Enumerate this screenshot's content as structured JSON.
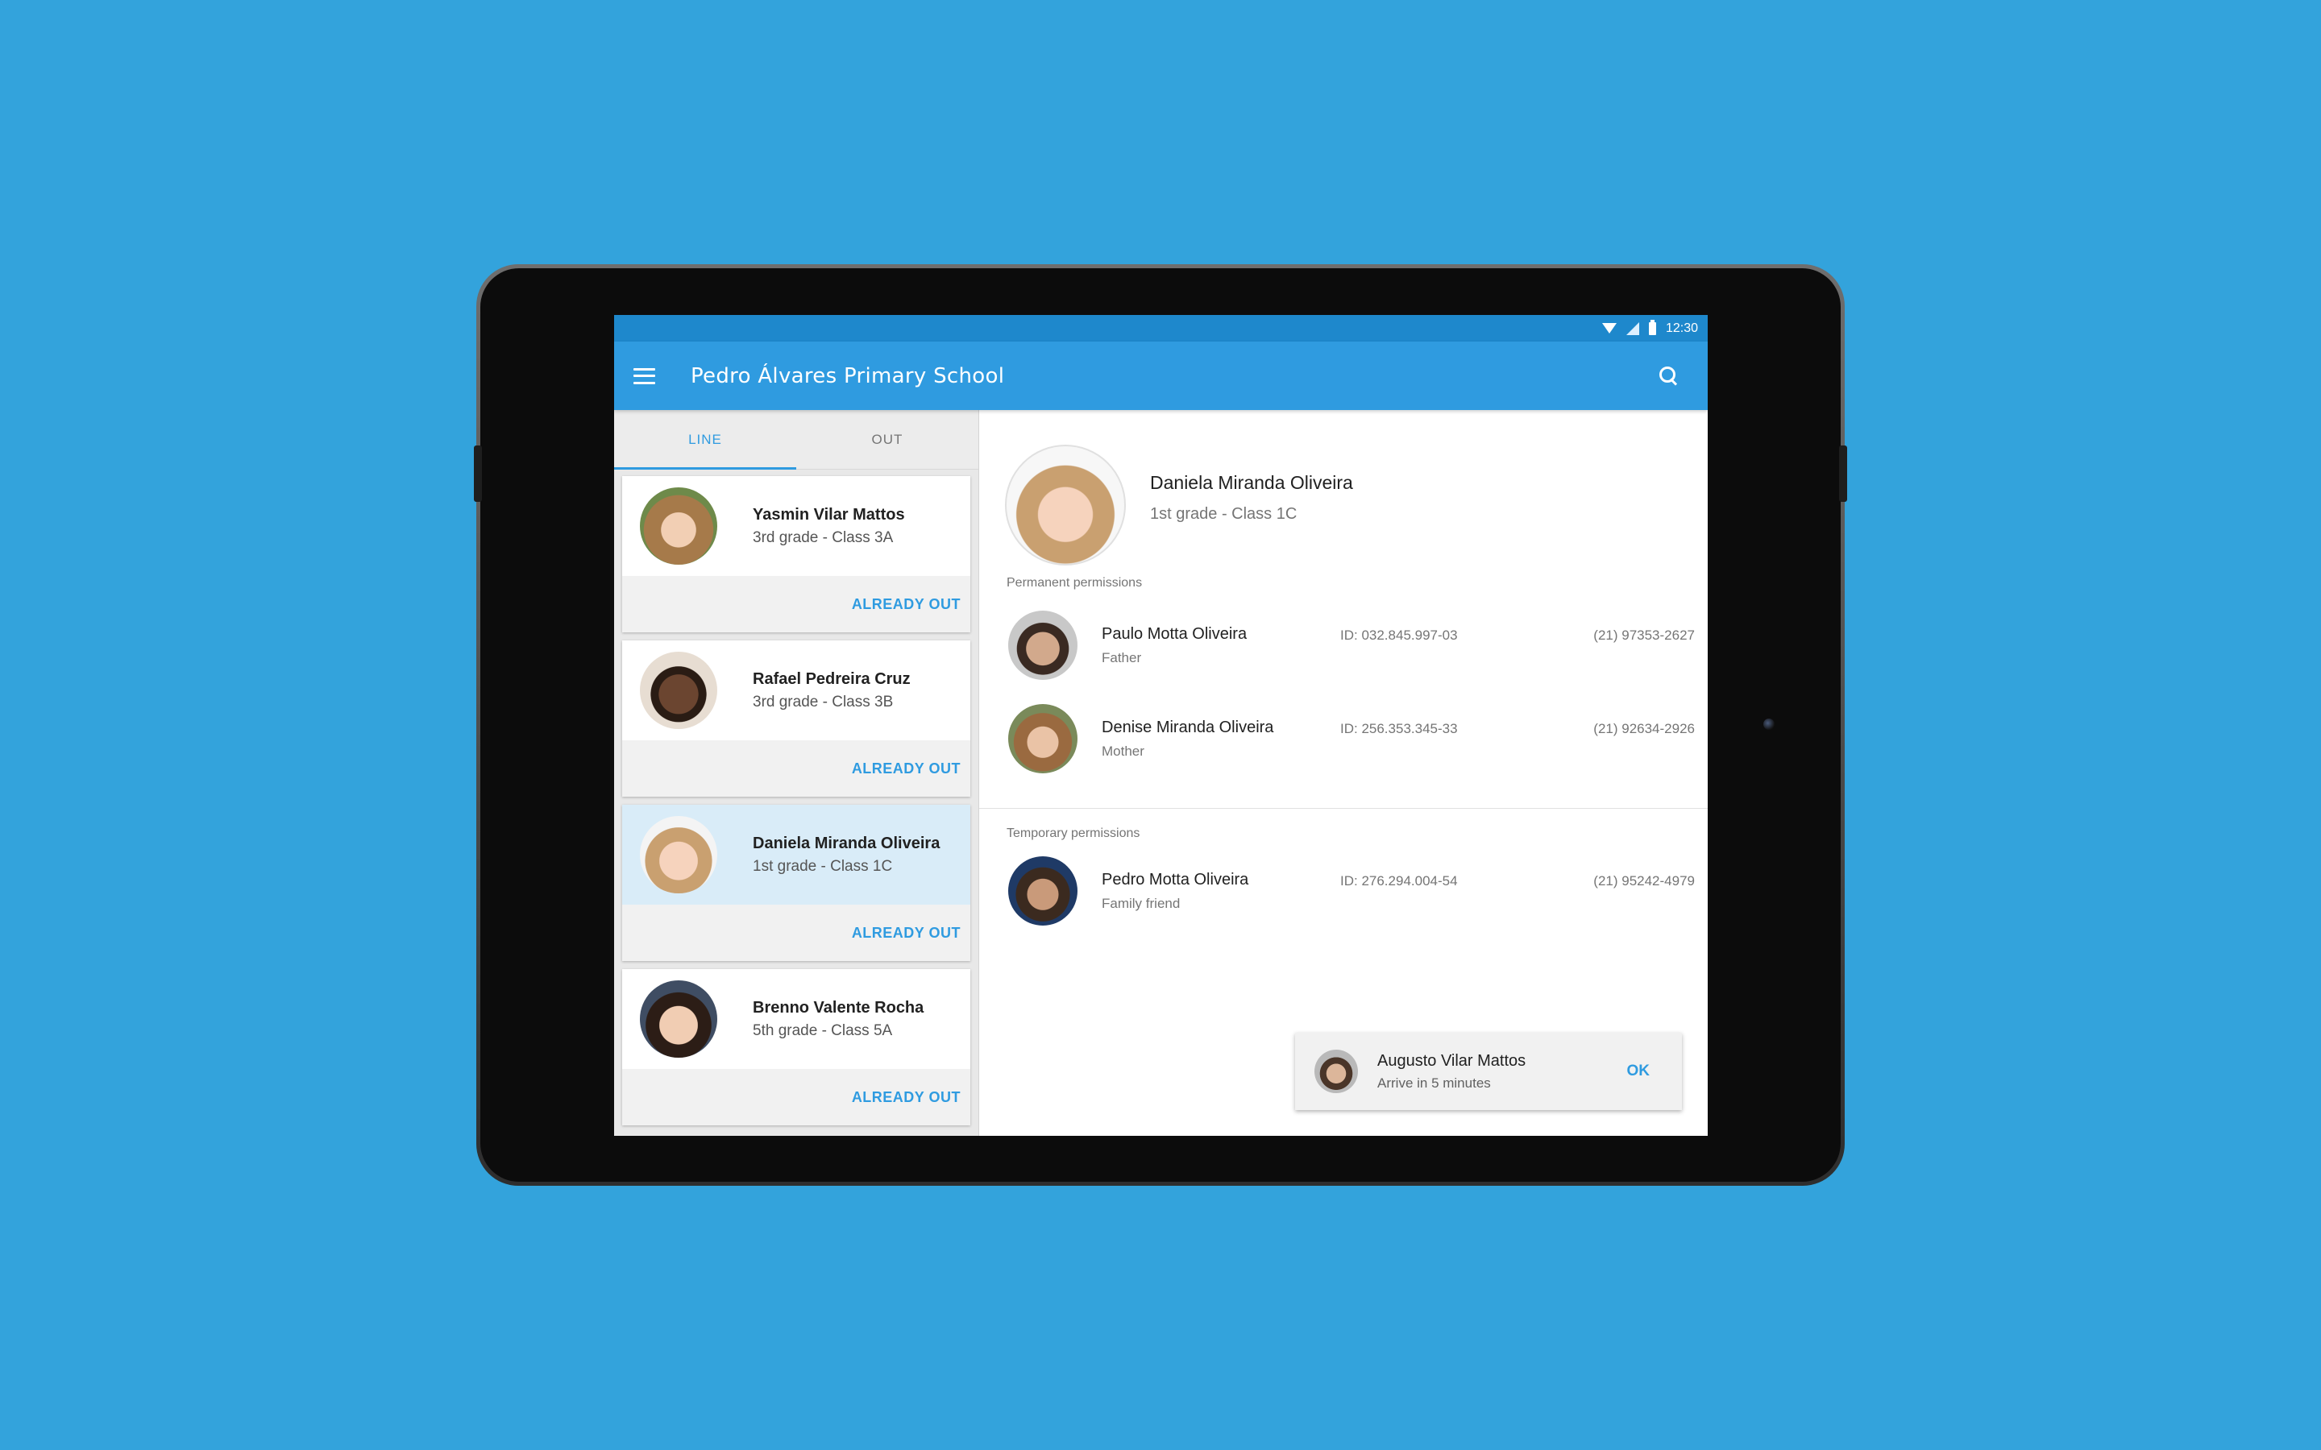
{
  "status_bar": {
    "time": "12:30"
  },
  "app_bar": {
    "title": "Pedro Álvares Primary School"
  },
  "tabs": [
    {
      "label": "LINE",
      "active": true
    },
    {
      "label": "OUT",
      "active": false
    }
  ],
  "students": [
    {
      "name": "Yasmin Vilar Mattos",
      "grade": "3rd grade - Class 3A",
      "action": "ALREADY OUT",
      "selected": false,
      "avatar": "girl-brown-hair-avatar"
    },
    {
      "name": "Rafael Pedreira Cruz",
      "grade": "3rd grade - Class 3B",
      "action": "ALREADY OUT",
      "selected": false,
      "avatar": "boy-avatar"
    },
    {
      "name": "Daniela Miranda Oliveira",
      "grade": "1st grade - Class 1C",
      "action": "ALREADY OUT",
      "selected": true,
      "avatar": "girl-blonde-avatar"
    },
    {
      "name": "Brenno Valente Rocha",
      "grade": "5th grade - Class 5A",
      "action": "ALREADY OUT",
      "selected": false,
      "avatar": "boy-avatar"
    }
  ],
  "detail": {
    "name": "Daniela Miranda Oliveira",
    "grade": "1st grade - Class 1C",
    "permanent_label": "Permanent permissions",
    "permanent": [
      {
        "name": "Paulo Motta Oliveira",
        "relation": "Father",
        "id": "ID: 032.845.997-03",
        "phone": "(21) 97353-2627"
      },
      {
        "name": "Denise Miranda Oliveira",
        "relation": "Mother",
        "id": "ID: 256.353.345-33",
        "phone": "(21) 92634-2926"
      }
    ],
    "temporary_label": "Temporary permissions",
    "temporary": [
      {
        "name": "Pedro Motta Oliveira",
        "relation": "Family friend",
        "id": "ID: 276.294.004-54",
        "phone": "(21) 95242-4979"
      }
    ]
  },
  "snackbar": {
    "name": "Augusto Vilar Mattos",
    "message": "Arrive in 5 minutes",
    "action": "OK"
  },
  "colors": {
    "background": "#33a3dc",
    "app_bar": "#2f9be0",
    "status_bar": "#1e88cc",
    "accent": "#2f9be0",
    "selected_card": "#d9ecf8"
  }
}
